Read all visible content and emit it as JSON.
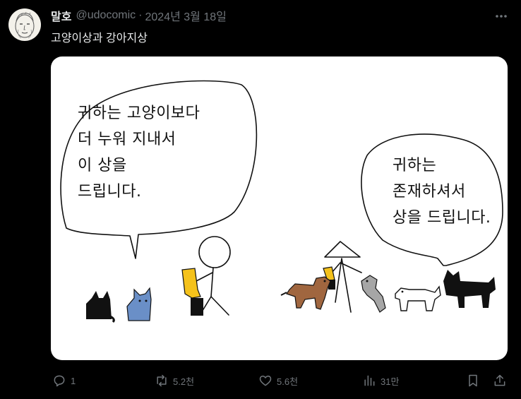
{
  "author": {
    "display_name": "말호",
    "handle": "@udocomic",
    "separator": "·",
    "date": "2024년 3월 18일"
  },
  "tweet": {
    "text": "고양이상과 강아지상"
  },
  "comic": {
    "left_bubble": "귀하는 고양이보다\n더 누워 지내서\n이 상을\n드립니다.",
    "right_bubble": "귀하는\n존재하셔서\n상을 드립니다."
  },
  "actions": {
    "replies": "1",
    "reposts": "5.2천",
    "likes": "5.6천",
    "views": "31만"
  },
  "icons": {
    "more": "more-icon",
    "reply": "reply-icon",
    "repost": "repost-icon",
    "like": "heart-icon",
    "views": "views-icon",
    "bookmark": "bookmark-icon",
    "share": "share-icon"
  },
  "colors": {
    "background": "#000000",
    "text_primary": "#e7e9ea",
    "text_secondary": "#71767b",
    "trophy_yellow": "#f5c21b",
    "dog_brown": "#a0663f",
    "cat_blue": "#6a8fc7"
  }
}
